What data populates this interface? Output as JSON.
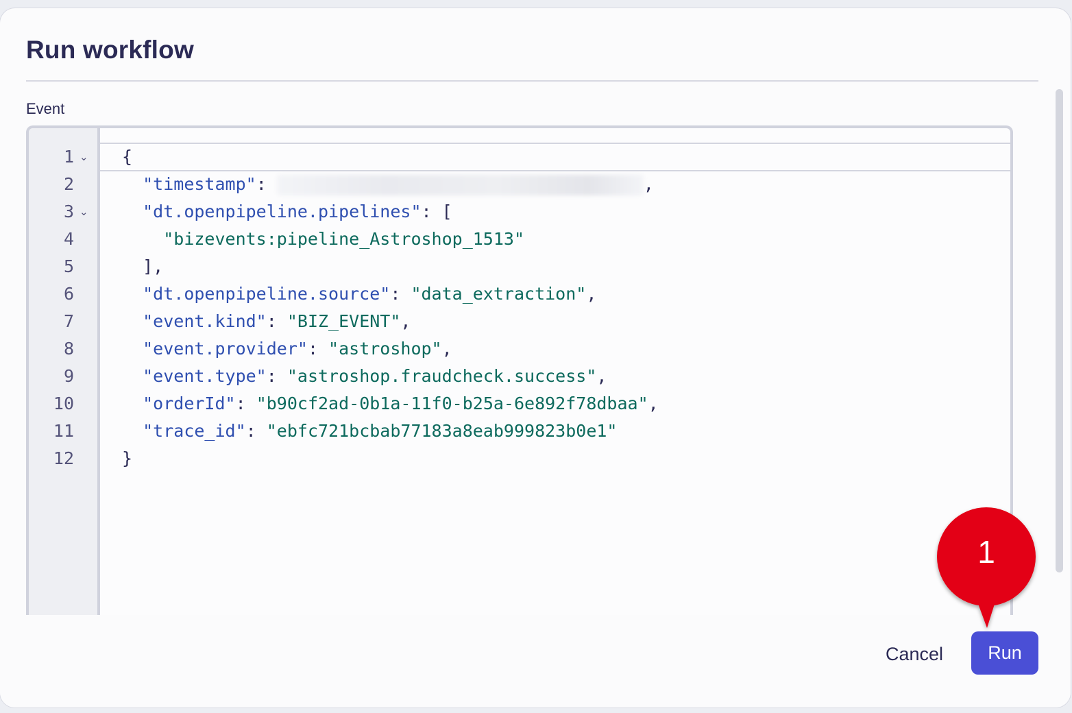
{
  "dialog": {
    "title": "Run workflow",
    "event_label": "Event"
  },
  "editor": {
    "line_numbers": [
      "1",
      "2",
      "3",
      "4",
      "5",
      "6",
      "7",
      "8",
      "9",
      "10",
      "11",
      "12"
    ],
    "foldable_lines": [
      1,
      3
    ],
    "lines": [
      {
        "indent": "",
        "parts": [
          {
            "t": "punc",
            "v": "{"
          }
        ]
      },
      {
        "indent": "  ",
        "parts": [
          {
            "t": "key",
            "v": "\"timestamp\""
          },
          {
            "t": "punc",
            "v": ": "
          },
          {
            "t": "redacted",
            "v": ""
          },
          {
            "t": "punc",
            "v": ","
          }
        ]
      },
      {
        "indent": "  ",
        "parts": [
          {
            "t": "key",
            "v": "\"dt.openpipeline.pipelines\""
          },
          {
            "t": "punc",
            "v": ": ["
          }
        ]
      },
      {
        "indent": "    ",
        "parts": [
          {
            "t": "str",
            "v": "\"bizevents:pipeline_Astroshop_1513\""
          }
        ]
      },
      {
        "indent": "  ",
        "parts": [
          {
            "t": "punc",
            "v": "],"
          }
        ]
      },
      {
        "indent": "  ",
        "parts": [
          {
            "t": "key",
            "v": "\"dt.openpipeline.source\""
          },
          {
            "t": "punc",
            "v": ": "
          },
          {
            "t": "str",
            "v": "\"data_extraction\""
          },
          {
            "t": "punc",
            "v": ","
          }
        ]
      },
      {
        "indent": "  ",
        "parts": [
          {
            "t": "key",
            "v": "\"event.kind\""
          },
          {
            "t": "punc",
            "v": ": "
          },
          {
            "t": "str",
            "v": "\"BIZ_EVENT\""
          },
          {
            "t": "punc",
            "v": ","
          }
        ]
      },
      {
        "indent": "  ",
        "parts": [
          {
            "t": "key",
            "v": "\"event.provider\""
          },
          {
            "t": "punc",
            "v": ": "
          },
          {
            "t": "str",
            "v": "\"astroshop\""
          },
          {
            "t": "punc",
            "v": ","
          }
        ]
      },
      {
        "indent": "  ",
        "parts": [
          {
            "t": "key",
            "v": "\"event.type\""
          },
          {
            "t": "punc",
            "v": ": "
          },
          {
            "t": "str",
            "v": "\"astroshop.fraudcheck.success\""
          },
          {
            "t": "punc",
            "v": ","
          }
        ]
      },
      {
        "indent": "  ",
        "parts": [
          {
            "t": "key",
            "v": "\"orderId\""
          },
          {
            "t": "punc",
            "v": ": "
          },
          {
            "t": "str",
            "v": "\"b90cf2ad-0b1a-11f0-b25a-6e892f78dbaa\""
          },
          {
            "t": "punc",
            "v": ","
          }
        ]
      },
      {
        "indent": "  ",
        "parts": [
          {
            "t": "key",
            "v": "\"trace_id\""
          },
          {
            "t": "punc",
            "v": ": "
          },
          {
            "t": "str",
            "v": "\"ebfc721bcbab77183a8eab999823b0e1\""
          }
        ]
      },
      {
        "indent": "",
        "parts": [
          {
            "t": "punc",
            "v": "}"
          }
        ]
      }
    ]
  },
  "footer": {
    "cancel_label": "Cancel",
    "run_label": "Run"
  },
  "annotation": {
    "step_number": "1",
    "color": "#e30613"
  },
  "colors": {
    "primary": "#4a4fd6",
    "title": "#2b2a55",
    "json_key": "#2f4fb0",
    "json_string": "#0d6a5d"
  }
}
